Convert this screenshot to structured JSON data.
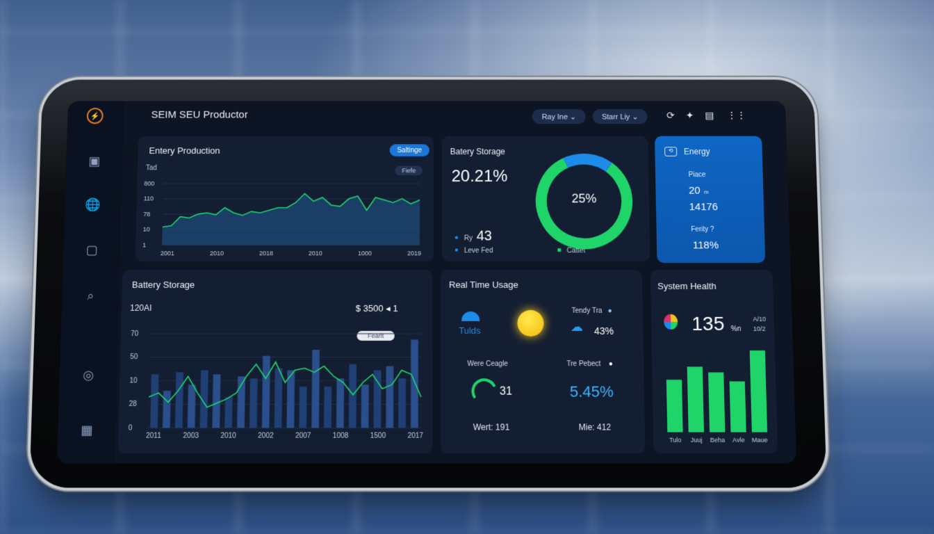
{
  "app": {
    "title": "SEIM SEU Productor"
  },
  "topbar": {
    "filter1": "Ray Ine ⌄",
    "filter2": "Starr Liy ⌄"
  },
  "colors": {
    "accent_green": "#1fd56a",
    "accent_blue": "#1d8be8",
    "card_bg": "#141e33",
    "energy_card": "#0f66c4"
  },
  "energy_production": {
    "title": "Entery Production",
    "button": "Saltinge",
    "chip": "Fiefe",
    "y_label_top": "Tad"
  },
  "battery_top": {
    "title": "Batery Storage",
    "percent": "20.21%",
    "donut_center": "25%",
    "stat_label": "Ry",
    "stat_value": "43",
    "legend1": "Leve Fed",
    "legend2": "Cattet"
  },
  "energy_card": {
    "title": "Energy",
    "label1": "Piace",
    "value1": "20",
    "value1_unit": "m",
    "value2": "14176",
    "label2": "Ferity ?",
    "value3": "118%"
  },
  "battery_bottom": {
    "title": "Battery Storage",
    "sub_left": "120AI",
    "sub_right": "$ 3500 ◂ 1",
    "chip": "Fearlt"
  },
  "realtime": {
    "title": "Real Time Usage",
    "icon_label": "Tulds",
    "r1_label": "Tendy Tra",
    "r1_value": "43%",
    "l2_label": "Were Ceagle",
    "l2_value": "31",
    "r2_label": "Tre Pebect",
    "r2_value": "5.45%",
    "foot_left": "Wert: 191",
    "foot_right": "Mie: 412"
  },
  "system_health": {
    "title": "System Health",
    "value": "135",
    "unit": "%n",
    "aux1": "A/10",
    "aux2": "10/2"
  },
  "chart_data": [
    {
      "type": "area",
      "title": "Entery Production",
      "categories": [
        "2001",
        "2010",
        "2018",
        "2010",
        "1000",
        "2019"
      ],
      "y_ticks": [
        "800",
        "110",
        "78",
        "10",
        "1"
      ],
      "ylim": [
        0,
        100
      ],
      "grid": true,
      "series": [
        {
          "values": [
            28,
            30,
            44,
            42,
            48,
            50,
            47,
            58,
            50,
            46,
            52,
            50,
            54,
            58,
            58,
            66,
            80,
            68,
            74,
            62,
            60,
            72,
            76,
            54,
            74,
            70,
            66,
            72,
            64,
            70
          ]
        }
      ]
    },
    {
      "type": "pie",
      "title": "Batery Storage",
      "slices": [
        {
          "label": "Leve Fed",
          "value": 17,
          "color": "#1d8be8"
        },
        {
          "label": "Cattet",
          "value": 83,
          "color": "#1fd56a"
        }
      ]
    },
    {
      "type": "bar",
      "title": "Battery Storage",
      "categories": [
        "2011",
        "2003",
        "2010",
        "2002",
        "2007",
        "1008",
        "1500",
        "2017"
      ],
      "y_ticks": [
        "70",
        "50",
        "10",
        "28",
        "0"
      ],
      "ylim": [
        0,
        100
      ],
      "bars": [
        52,
        36,
        54,
        42,
        56,
        52,
        30,
        50,
        48,
        70,
        58,
        56,
        40,
        76,
        40,
        48,
        62,
        42,
        56,
        60,
        48,
        86
      ],
      "line": [
        30,
        34,
        25,
        36,
        50,
        34,
        20,
        24,
        28,
        34,
        50,
        62,
        48,
        64,
        44,
        56,
        58,
        54,
        60,
        50,
        44,
        32,
        44,
        52,
        38,
        42,
        56,
        52,
        30
      ]
    },
    {
      "type": "bar",
      "title": "System Health",
      "categories": [
        "Tulo",
        "Juuj",
        "Beha",
        "Avle",
        "Maue"
      ],
      "values": [
        64,
        80,
        73,
        62,
        100
      ]
    }
  ]
}
